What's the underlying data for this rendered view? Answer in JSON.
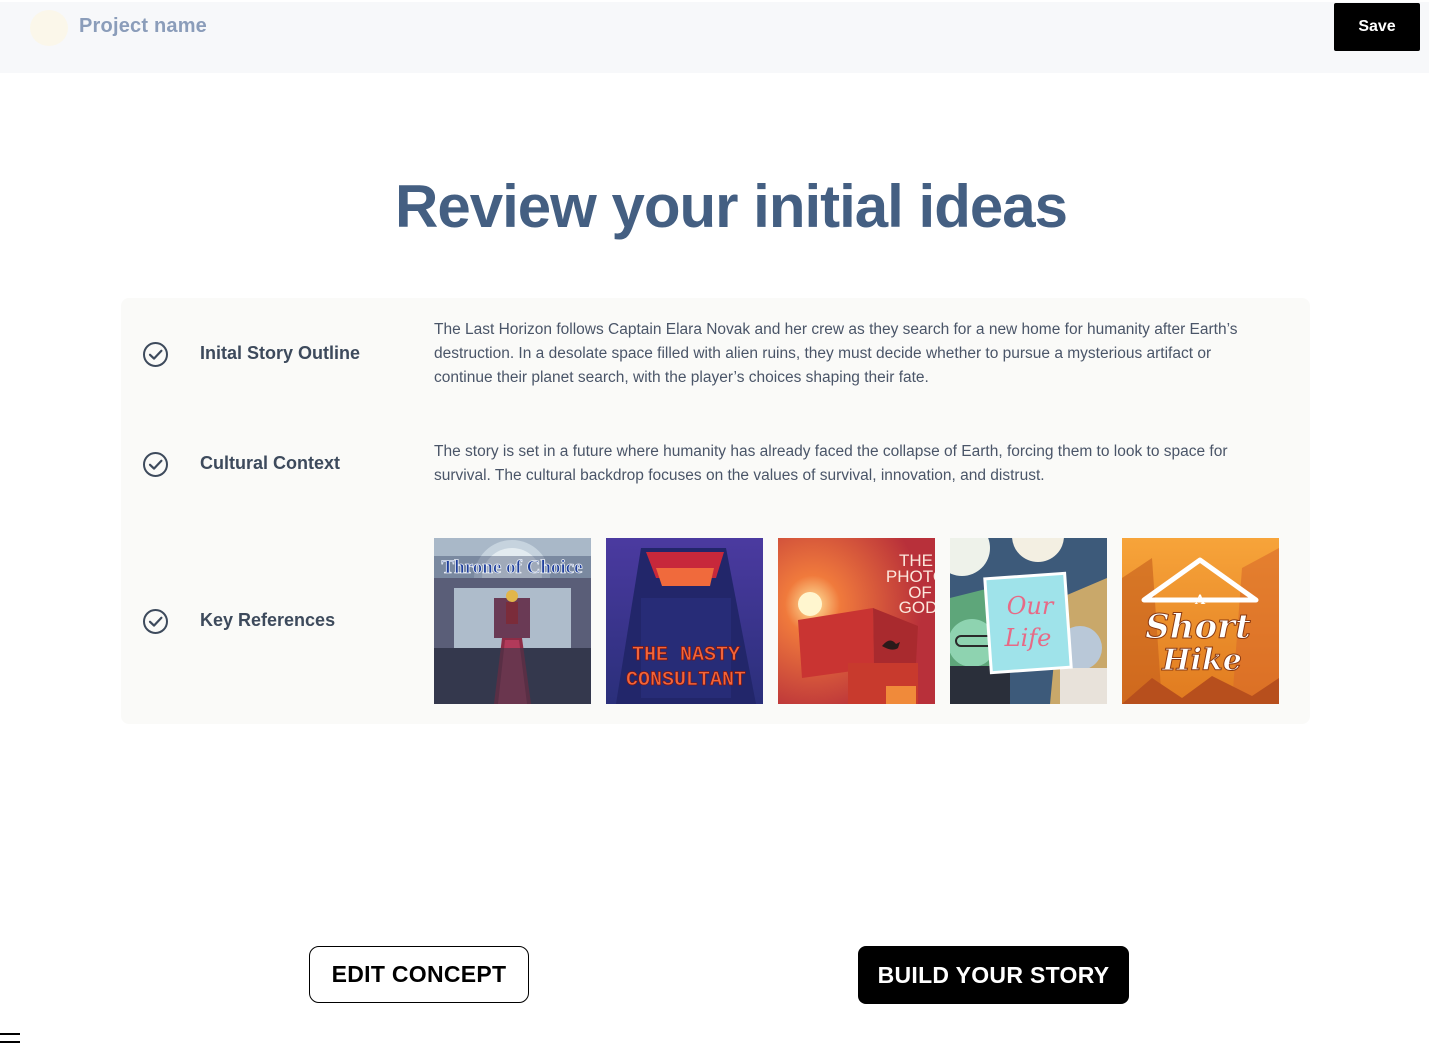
{
  "header": {
    "project_name": "Project name",
    "save_label": "Save"
  },
  "main": {
    "title": "Review your initial ideas",
    "rows": [
      {
        "label": "Inital Story Outline",
        "text": "The Last Horizon follows Captain Elara Novak and her crew as they search for a new home for humanity after Earth’s destruction. In a desolate space filled with alien ruins, they must decide whether to pursue a mysterious artifact or continue their planet search, with the player’s choices shaping their fate."
      },
      {
        "label": "Cultural Context",
        "text": "The story is set in a future where humanity has already faced the collapse of Earth, forcing them to look to space for survival. The cultural backdrop focuses on the values of survival, innovation, and distrust."
      },
      {
        "label": "Key References",
        "references": [
          {
            "title": "Throne of Choice"
          },
          {
            "title_line1": "THE NASTY",
            "title_line2": "CONSULTANT"
          },
          {
            "title_line1": "THE",
            "title_line2": "PHOTO",
            "title_line3": "OF",
            "title_line4": "GOD"
          },
          {
            "title_line1": "Our",
            "title_line2": "Life"
          },
          {
            "title_line1": "A",
            "title_line2": "Short",
            "title_line3": "Hike"
          }
        ]
      }
    ]
  },
  "actions": {
    "edit_label": "EDIT CONCEPT",
    "build_label": "BUILD YOUR STORY"
  },
  "colors": {
    "title": "#445f82",
    "project_name": "#8b9dba",
    "card_bg": "#fafaf8"
  }
}
